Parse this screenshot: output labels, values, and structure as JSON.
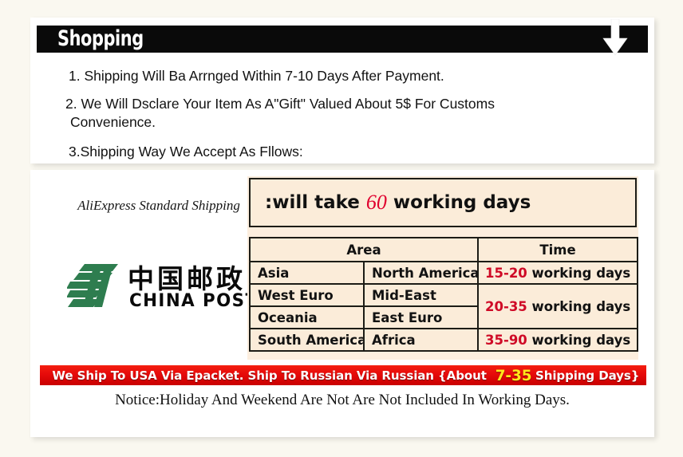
{
  "shopping": {
    "title": "Shopping",
    "arrow_icon": "arrow-down-icon",
    "line1": "1. Shipping Will Ba Arrnged Within 7-10 Days After Payment.",
    "line2": "2. We Will Dsclare Your Item As A\"Gift\" Valued About 5$ For Customs",
    "line2_cont": "Convenience.",
    "line3": "3.Shipping Way We Accept As Fllows:"
  },
  "shipping": {
    "carrier_label": "AliExpress Standard Shipping",
    "logo": {
      "icon": "china-post-emblem-icon",
      "chinese_name": "中国邮政",
      "english_name": "CHINA POST",
      "color": "#2e7d4f"
    },
    "will_take": {
      "prefix": ":will take",
      "days": "60",
      "suffix": "working days",
      "days_color": "#e0002e"
    },
    "table": {
      "headers": [
        "Area",
        "Time"
      ],
      "rows": [
        {
          "area1": "Asia",
          "area2": "North America",
          "time_range": "15-20",
          "time_unit": "working days"
        },
        {
          "area1": "West Euro",
          "area2": "Mid-East",
          "time_range": "20-35",
          "time_unit": "working days"
        },
        {
          "area1": "Oceania",
          "area2": "East Euro"
        },
        {
          "area1": "South America",
          "area2": "Africa",
          "time_range": "35-90",
          "time_unit": "working days"
        }
      ]
    },
    "banner": {
      "text_before": "We Ship To USA Via Epacket. Ship To Russian Via Russian {About",
      "highlight": "7-35",
      "text_after": "Shipping Days}",
      "bg_color": "#e60a0a",
      "highlight_color": "#ffe81a"
    },
    "notice": "Notice:Holiday And Weekend Are Not Are Not Included In Working Days."
  }
}
